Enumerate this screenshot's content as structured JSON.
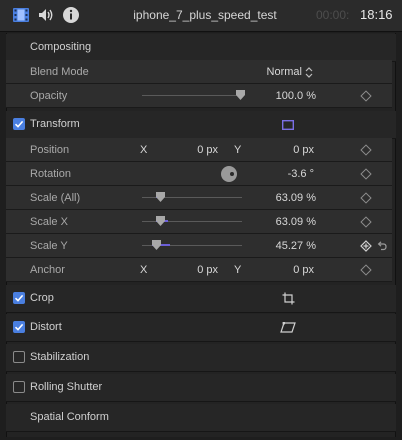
{
  "header": {
    "title": "iphone_7_plus_speed_test",
    "timecode_dim": "00:00:",
    "timecode": "18:16"
  },
  "sections": {
    "compositing": "Compositing",
    "transform": "Transform",
    "crop": "Crop",
    "distort": "Distort",
    "stabilization": "Stabilization",
    "rolling_shutter": "Rolling Shutter",
    "spatial_conform": "Spatial Conform"
  },
  "compositing": {
    "blend_mode_label": "Blend Mode",
    "blend_mode_value": "Normal",
    "opacity_label": "Opacity",
    "opacity_value": "100.0 %",
    "opacity_level": 1.0
  },
  "transform": {
    "position_label": "Position",
    "x_axis": "X",
    "y_axis": "Y",
    "position_x": "0 px",
    "position_y": "0 px",
    "rotation_label": "Rotation",
    "rotation_value": "-3.6 °",
    "scale_all_label": "Scale (All)",
    "scale_all_value": "63.09 %",
    "scale_x_label": "Scale X",
    "scale_x_value": "63.09 %",
    "scale_y_label": "Scale Y",
    "scale_y_value": "45.27 %",
    "anchor_label": "Anchor",
    "anchor_x": "0 px",
    "anchor_y": "0 px"
  },
  "checks": {
    "transform": true,
    "crop": true,
    "distort": true,
    "stabilization": false,
    "rolling_shutter": false
  },
  "colors": {
    "accent": "#4a7fe0",
    "slider_fill": "#6c5fd8",
    "onscreen_icon": "#7b6fe6"
  }
}
